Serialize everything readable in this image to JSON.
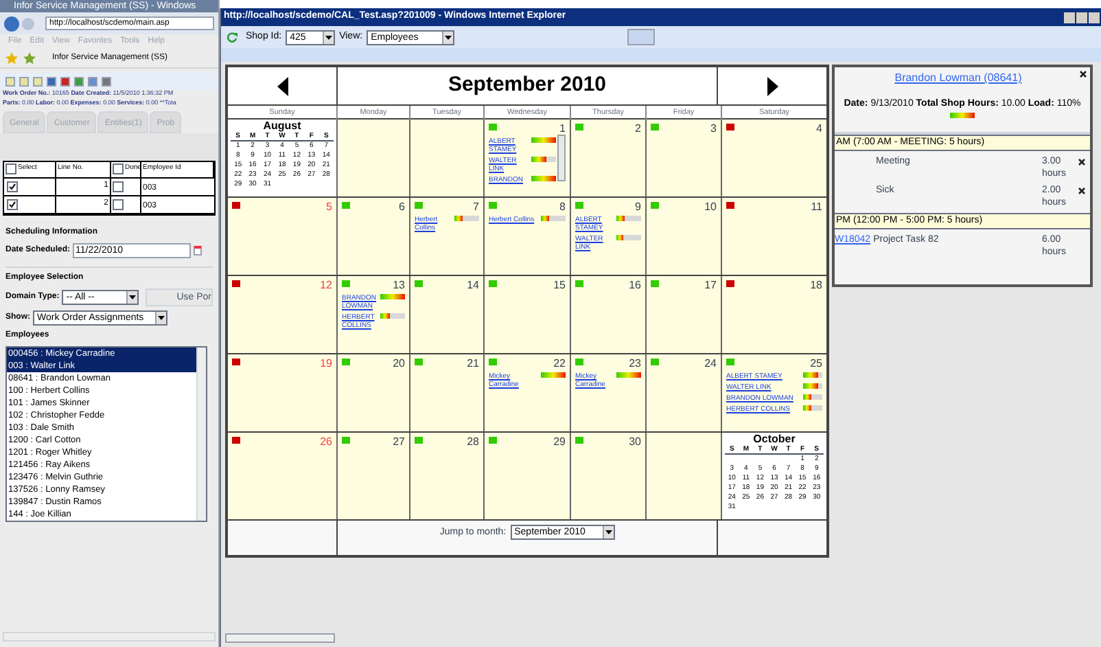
{
  "left_window": {
    "title": "Infor Service Management (SS) - Windows",
    "address": "http://localhost/scdemo/main.asp",
    "menu": [
      "File",
      "Edit",
      "View",
      "Favorites",
      "Tools",
      "Help"
    ],
    "favorite_tab": "Infor Service Management (SS)",
    "work_order_line": "**Work Order No.:** 10165 **Date Created:** 11/5/2010 1:36:32 PM",
    "totals_line": "**Parts:** 0.00 **Labor:** 0.00 **Expenses:** 0.00 **Services:** 0.00 **Tota",
    "tabs": [
      {
        "label": "General",
        "selected": false
      },
      {
        "label": "Customer",
        "selected": false
      },
      {
        "label": "Entities(1)",
        "selected": false
      },
      {
        "label": "Prob",
        "selected": false
      }
    ],
    "table": {
      "columns": [
        {
          "label": "Select",
          "checked": false
        },
        {
          "label": "Line No."
        },
        {
          "label": "Done",
          "checked": false
        },
        {
          "label": "Employee Id"
        }
      ],
      "rows": [
        {
          "select_checked": true,
          "line_no": "1",
          "done_checked": false,
          "employee_id": "003"
        },
        {
          "select_checked": true,
          "line_no": "2",
          "done_checked": false,
          "employee_id": "003"
        }
      ]
    },
    "scheduling": {
      "heading": "Scheduling Information",
      "date_label": "Date Scheduled:",
      "date_value": "11/22/2010"
    },
    "employee_selection": {
      "heading": "Employee Selection",
      "domain_label": "Domain Type:",
      "domain_value": "-- All --",
      "use_button": "Use Por",
      "show_label": "Show:",
      "show_value": "Work Order Assignments",
      "list_label": "Employees",
      "employees": [
        {
          "label": "000456 : Mickey Carradine",
          "selected": true
        },
        {
          "label": "003 : Walter Link",
          "selected": true
        },
        {
          "label": "08641 : Brandon Lowman",
          "selected": false
        },
        {
          "label": "100 : Herbert Collins",
          "selected": false
        },
        {
          "label": "101 : James Skinner",
          "selected": false
        },
        {
          "label": "102 : Christopher Fedde",
          "selected": false
        },
        {
          "label": "103 : Dale Smith",
          "selected": false
        },
        {
          "label": "1200 : Carl Cotton",
          "selected": false
        },
        {
          "label": "1201 : Roger Whitley",
          "selected": false
        },
        {
          "label": "121456 : Ray Aikens",
          "selected": false
        },
        {
          "label": "123476 : Melvin Guthrie",
          "selected": false
        },
        {
          "label": "137526 : Lonny Ramsey",
          "selected": false
        },
        {
          "label": "139847 : Dustin Ramos",
          "selected": false
        },
        {
          "label": "144 : Joe Killian",
          "selected": false
        }
      ]
    }
  },
  "ie_window": {
    "title": "http://localhost/scdemo/CAL_Test.asp?201009 - Windows Internet Explorer",
    "shop_label": "Shop Id:",
    "shop_value": "425",
    "view_label": "View:",
    "view_value": "Employees"
  },
  "calendar": {
    "title": "September 2010",
    "weekdays": [
      "Sunday",
      "Monday",
      "Tuesday",
      "Wednesday",
      "Thursday",
      "Friday",
      "Saturday"
    ],
    "weeks": [
      [
        {
          "kind": "mini_month",
          "title": "August",
          "weekdays": [
            "S",
            "M",
            "T",
            "W",
            "T",
            "F",
            "S"
          ],
          "weeks": [
            [
              "1",
              "2",
              "3",
              "4",
              "5",
              "6",
              "7"
            ],
            [
              "8",
              "9",
              "10",
              "11",
              "12",
              "13",
              "14"
            ],
            [
              "15",
              "16",
              "17",
              "18",
              "19",
              "20",
              "21"
            ],
            [
              "22",
              "23",
              "24",
              "25",
              "26",
              "27",
              "28"
            ],
            [
              "29",
              "30",
              "31"
            ]
          ]
        },
        {
          "kind": "blank"
        },
        {
          "kind": "blank"
        },
        {
          "kind": "day",
          "number": "1",
          "color": "#33cc00",
          "scrollable": true,
          "entries": [
            {
              "name": "ALBERT STAMEY",
              "level": 1
            },
            {
              "name": "WALTER LINK",
              "level": 0.6
            },
            {
              "name": "BRANDON",
              "level": 1
            }
          ]
        },
        {
          "kind": "day",
          "number": "2",
          "color": "#33cc00"
        },
        {
          "kind": "day",
          "number": "3",
          "color": "#33cc00"
        },
        {
          "kind": "day",
          "number": "4",
          "color": "#cc0000"
        }
      ],
      [
        {
          "kind": "day",
          "number": "5",
          "color": "#cc0000"
        },
        {
          "kind": "day",
          "number": "6",
          "color": "#33cc00"
        },
        {
          "kind": "day",
          "number": "7",
          "color": "#33cc00",
          "entries": [
            {
              "name": "Herbert Collins",
              "level": 0.35
            }
          ]
        },
        {
          "kind": "day",
          "number": "8",
          "color": "#33cc00",
          "entries": [
            {
              "name": "Herbert Collins",
              "level": 0.35
            }
          ]
        },
        {
          "kind": "day",
          "number": "9",
          "color": "#33cc00",
          "entries": [
            {
              "name": "ALBERT STAMEY",
              "level": 0.35
            },
            {
              "name": "WALTER LINK",
              "level": 0.3
            }
          ]
        },
        {
          "kind": "day",
          "number": "10",
          "color": "#33cc00"
        },
        {
          "kind": "day",
          "number": "11",
          "color": "#cc0000"
        }
      ],
      [
        {
          "kind": "day",
          "number": "12",
          "color": "#cc0000"
        },
        {
          "kind": "day",
          "number": "13",
          "color": "#33cc00",
          "entries": [
            {
              "name": "BRANDON LOWMAN",
              "level": 1
            },
            {
              "name": "HERBERT COLLINS",
              "level": 0.4
            }
          ]
        },
        {
          "kind": "day",
          "number": "14",
          "color": "#33cc00"
        },
        {
          "kind": "day",
          "number": "15",
          "color": "#33cc00"
        },
        {
          "kind": "day",
          "number": "16",
          "color": "#33cc00"
        },
        {
          "kind": "day",
          "number": "17",
          "color": "#33cc00"
        },
        {
          "kind": "day",
          "number": "18",
          "color": "#cc0000"
        }
      ],
      [
        {
          "kind": "day",
          "number": "19",
          "color": "#cc0000"
        },
        {
          "kind": "day",
          "number": "20",
          "color": "#33cc00"
        },
        {
          "kind": "day",
          "number": "21",
          "color": "#33cc00"
        },
        {
          "kind": "day",
          "number": "22",
          "color": "#33cc00",
          "entries": [
            {
              "name": "Mickey Carradine",
              "level": 1
            }
          ]
        },
        {
          "kind": "day",
          "number": "23",
          "color": "#33cc00",
          "entries": [
            {
              "name": "Mickey Carradine",
              "level": 1
            }
          ]
        },
        {
          "kind": "day",
          "number": "24",
          "color": "#33cc00"
        },
        {
          "kind": "day",
          "number": "25",
          "color": "#33cc00",
          "entries": [
            {
              "name": "ALBERT STAMEY",
              "level": 0.8
            },
            {
              "name": "WALTER LINK",
              "level": 0.8
            },
            {
              "name": "BRANDON LOWMAN",
              "level": 0.4
            },
            {
              "name": "HERBERT COLLINS",
              "level": 0.4
            }
          ]
        }
      ],
      [
        {
          "kind": "day",
          "number": "26",
          "color": "#cc0000"
        },
        {
          "kind": "day",
          "number": "27",
          "color": "#33cc00"
        },
        {
          "kind": "day",
          "number": "28",
          "color": "#33cc00"
        },
        {
          "kind": "day",
          "number": "29",
          "color": "#33cc00"
        },
        {
          "kind": "day",
          "number": "30",
          "color": "#33cc00"
        },
        {
          "kind": "blank"
        },
        {
          "kind": "mini_month",
          "title": "October",
          "weekdays": [
            "S",
            "M",
            "T",
            "W",
            "T",
            "F",
            "S"
          ],
          "weeks": [
            [
              "1",
              "2"
            ],
            [
              "3",
              "4",
              "5",
              "6",
              "7",
              "8",
              "9"
            ],
            [
              "10",
              "11",
              "12",
              "13",
              "14",
              "15",
              "16"
            ],
            [
              "17",
              "18",
              "19",
              "20",
              "21",
              "22",
              "23"
            ],
            [
              "24",
              "25",
              "26",
              "27",
              "28",
              "29",
              "30"
            ],
            [
              "31"
            ]
          ]
        }
      ]
    ],
    "jump_label": "Jump to month:",
    "jump_value": "September 2010"
  },
  "detail": {
    "employee": "Brandon Lowman (08641)",
    "summary": "**Date:** 9/13/2010 **Total Shop Hours:** 10.00 **Load:** 110%",
    "load": {
      "level": 1
    },
    "sections": [
      {
        "heading": "AM (7:00 AM - MEETING: 5 hours)",
        "items": [
          {
            "kind": "plain",
            "label": "Meeting",
            "hours": "3.00 hours",
            "removable": true
          },
          {
            "kind": "plain",
            "label": "Sick",
            "hours": "2.00 hours",
            "removable": true
          }
        ]
      },
      {
        "heading": "PM (12:00 PM - 5:00 PM: 5 hours)",
        "items": [
          {
            "kind": "linked",
            "link": "W18042",
            "label": "Project Task 82",
            "hours": "6.00 hours",
            "removable": false
          }
        ]
      }
    ]
  }
}
